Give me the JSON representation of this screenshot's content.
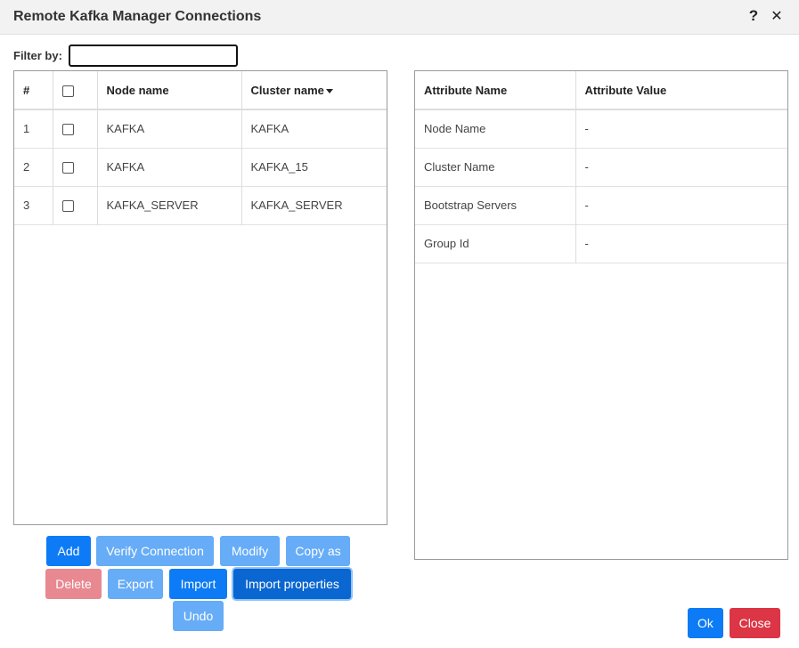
{
  "dialog": {
    "title": "Remote Kafka Manager Connections",
    "help_label": "?",
    "close_label": "✕"
  },
  "filter": {
    "label": "Filter by:",
    "value": "",
    "placeholder": ""
  },
  "connections_table": {
    "headers": {
      "index": "#",
      "node_name": "Node name",
      "cluster_name": "Cluster name"
    },
    "rows": [
      {
        "index": "1",
        "node_name": "KAFKA",
        "cluster_name": "KAFKA"
      },
      {
        "index": "2",
        "node_name": "KAFKA",
        "cluster_name": "KAFKA_15"
      },
      {
        "index": "3",
        "node_name": "KAFKA_SERVER",
        "cluster_name": "KAFKA_SERVER"
      }
    ]
  },
  "attributes_table": {
    "headers": {
      "name": "Attribute Name",
      "value": "Attribute Value"
    },
    "rows": [
      {
        "name": "Node Name",
        "value": "-"
      },
      {
        "name": "Cluster Name",
        "value": "-"
      },
      {
        "name": "Bootstrap Servers",
        "value": "-"
      },
      {
        "name": "Group Id",
        "value": "-"
      }
    ]
  },
  "actions": {
    "add": "Add",
    "verify": "Verify Connection",
    "modify": "Modify",
    "copy_as": "Copy as",
    "delete": "Delete",
    "export": "Export",
    "import": "Import",
    "import_properties": "Import properties",
    "undo": "Undo"
  },
  "footer": {
    "ok": "Ok",
    "close": "Close"
  },
  "colors": {
    "primary": "#0d7bf5",
    "primary_light": "#66acf7",
    "danger": "#dc3545",
    "danger_light": "#e88890",
    "header_bg": "#f2f2f2"
  }
}
